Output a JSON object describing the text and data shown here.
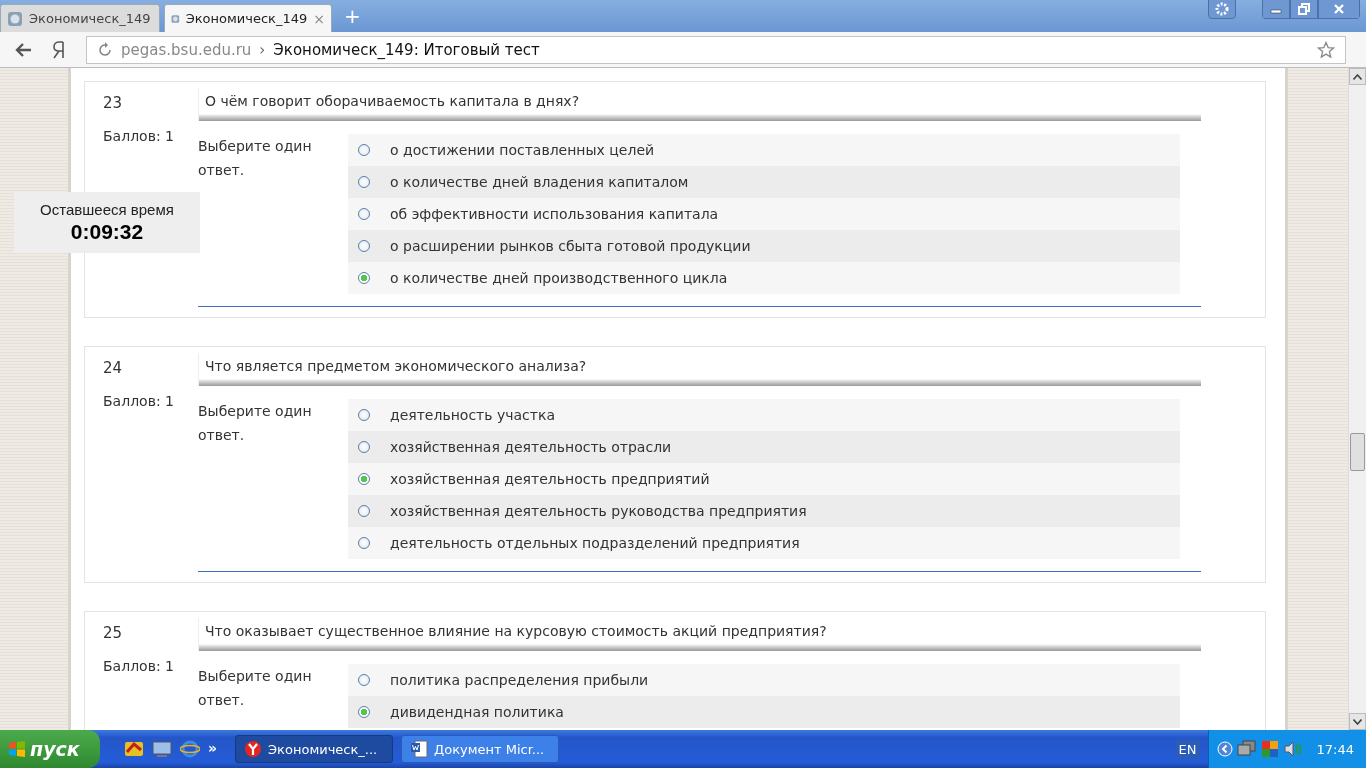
{
  "browser": {
    "tabs": [
      {
        "title": "Экономическ_149",
        "selected": false
      },
      {
        "title": "Экономическ_149",
        "selected": true
      }
    ],
    "close_tab": "×",
    "new_tab": "+",
    "address": {
      "domain": "pegas.bsu.edu.ru",
      "separator": "›",
      "page_title": "Экономическ_149: Итоговый тест"
    }
  },
  "timer": {
    "label": "Оставшееся время",
    "value": "0:09:32"
  },
  "questions": [
    {
      "number": "23",
      "points": "Баллов: 1",
      "text": "О чём говорит оборачиваемость капитала в днях?",
      "prompt": "Выберите один ответ.",
      "options": [
        {
          "text": "о достижении поставленных целей",
          "selected": false
        },
        {
          "text": "о количестве дней владения капиталом",
          "selected": false
        },
        {
          "text": "об эффективности использования капитала",
          "selected": false
        },
        {
          "text": "о расширении рынков сбыта готовой продукции",
          "selected": false
        },
        {
          "text": "о количестве дней производственного цикла",
          "selected": true
        }
      ]
    },
    {
      "number": "24",
      "points": "Баллов: 1",
      "text": "Что является предметом экономического анализа?",
      "prompt": "Выберите один ответ.",
      "options": [
        {
          "text": "деятельность участка",
          "selected": false
        },
        {
          "text": "хозяйственная деятельность отрасли",
          "selected": false
        },
        {
          "text": "хозяйственная деятельность предприятий",
          "selected": true
        },
        {
          "text": "хозяйственная деятельность руководства предприятия",
          "selected": false
        },
        {
          "text": "деятельность отдельных подразделений предприятия",
          "selected": false
        }
      ]
    },
    {
      "number": "25",
      "points": "Баллов: 1",
      "text": "Что оказывает существенное влияние на курсовую стоимость акций предприятия?",
      "prompt": "Выберите один ответ.",
      "options": [
        {
          "text": "политика распределения прибыли",
          "selected": false
        },
        {
          "text": "дивидендная политика",
          "selected": true
        }
      ]
    }
  ],
  "taskbar": {
    "start": "пуск",
    "more": "»",
    "tasks": [
      {
        "title": "Экономическ_...",
        "selected": true,
        "kind": "browser"
      },
      {
        "title": "Документ Micr...",
        "selected": false,
        "kind": "word"
      }
    ],
    "language": "EN",
    "clock": "17:44"
  }
}
